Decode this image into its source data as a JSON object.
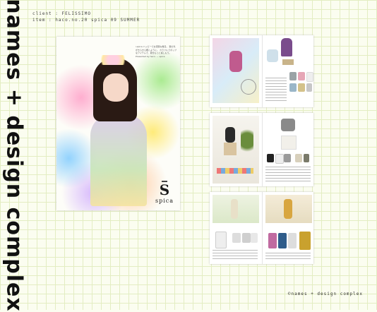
{
  "studio": {
    "name": "names + design complex",
    "copyright": "©names + design complex"
  },
  "meta": {
    "client": "client : FELISSIMO",
    "item": "item : haco.no.20 spica 09 SUMMER"
  },
  "cover": {
    "intro": "i-spica ハッピーでお洒落な毎日。 夏の光がきらきら輝くように。 カラフルでポップなアイテムで、夏をもっと楽しもう。 Presented by haco. — spica",
    "logo_mark": "S",
    "logo_word": "spica"
  },
  "colors": {
    "grid": "#e3edc2",
    "background": "#fbfdf0",
    "text": "#111111"
  }
}
